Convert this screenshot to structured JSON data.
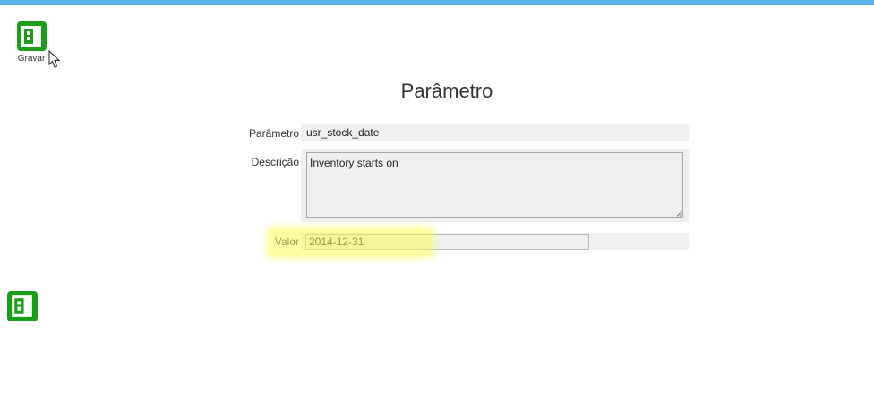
{
  "colors": {
    "top_bar": "#5bb4e8",
    "save_icon": "#1a9e1a",
    "highlight": "#fafa5a"
  },
  "toolbar": {
    "save_label": "Gravar",
    "save_icon": "save-icon"
  },
  "page": {
    "title": "Parâmetro"
  },
  "form": {
    "param_label": "Parâmetro",
    "param_value": "usr_stock_date",
    "desc_label": "Descrição",
    "desc_value": "Inventory starts on",
    "valor_label": "Valor",
    "valor_value": "2014-12-31"
  },
  "footer": {
    "save_icon": "save-icon"
  }
}
